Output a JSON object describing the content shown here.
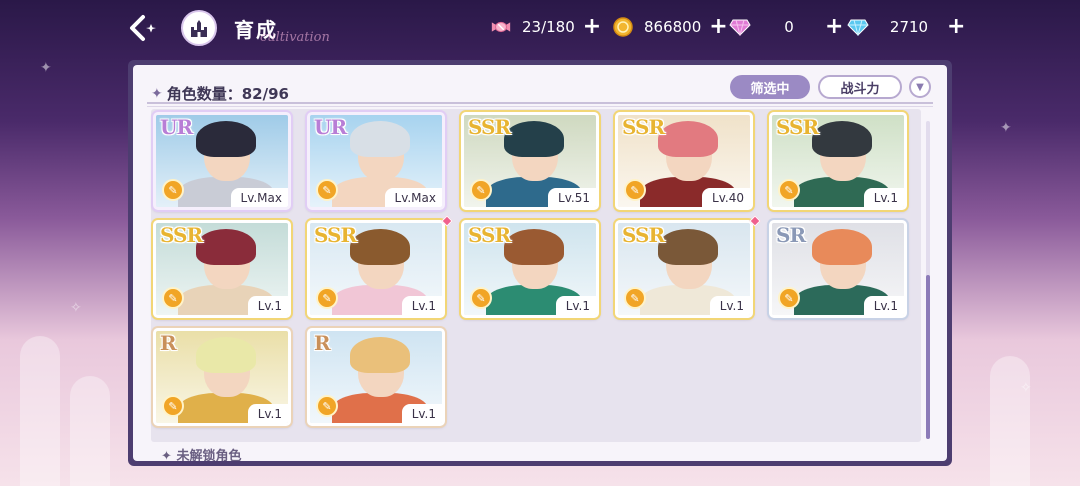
{
  "header": {
    "title": "育成",
    "title_script": "cultivation"
  },
  "resources": [
    {
      "name": "candy",
      "icon": "candy-icon",
      "value": "23/180",
      "color": "#f08fb0"
    },
    {
      "name": "coin",
      "icon": "coin-icon",
      "value": "866800",
      "color": "#f2b630"
    },
    {
      "name": "pink-diamond",
      "icon": "pink-diamond-icon",
      "value": "0",
      "color": "#e07ad4"
    },
    {
      "name": "blue-diamond",
      "icon": "blue-diamond-icon",
      "value": "2710",
      "color": "#5ac8f0"
    }
  ],
  "panel": {
    "count_label": "角色数量：82/96",
    "filter_label": "筛选中",
    "sort_label": "战斗力",
    "locked_label": "未解锁角色"
  },
  "characters": [
    {
      "rarity": "UR",
      "level": "Lv.Max",
      "sky": "#9fcbe8",
      "hair": "#2a2a3a",
      "body": "#c9ccd6",
      "new": false
    },
    {
      "rarity": "UR",
      "level": "Lv.Max",
      "sky": "#a7d3ef",
      "hair": "#d8dfe6",
      "body": "#f3d6c0",
      "new": false
    },
    {
      "rarity": "SSR",
      "level": "Lv.51",
      "sky": "#cfd9c0",
      "hair": "#24404a",
      "body": "#2e6a8c",
      "new": false
    },
    {
      "rarity": "SSR",
      "level": "Lv.40",
      "sky": "#f0e2c9",
      "hair": "#e27a80",
      "body": "#8a2a2a",
      "new": false
    },
    {
      "rarity": "SSR",
      "level": "Lv.1",
      "sky": "#cfe0c6",
      "hair": "#33393f",
      "body": "#2f6a54",
      "new": false
    },
    {
      "rarity": "SSR",
      "level": "Lv.1",
      "sky": "#c4dcd8",
      "hair": "#8a2c3a",
      "body": "#e8d3b8",
      "new": false
    },
    {
      "rarity": "SSR",
      "level": "Lv.1",
      "sky": "#d8e8f2",
      "hair": "#8a5a2e",
      "body": "#f1c6d6",
      "new": true
    },
    {
      "rarity": "SSR",
      "level": "Lv.1",
      "sky": "#cfe4ee",
      "hair": "#9a5a32",
      "body": "#2c8c72",
      "new": false
    },
    {
      "rarity": "SSR",
      "level": "Lv.1",
      "sky": "#d9e6ef",
      "hair": "#7a5838",
      "body": "#efe8d8",
      "new": true
    },
    {
      "rarity": "SR",
      "level": "Lv.1",
      "sky": "#dfe0e6",
      "hair": "#e88a5a",
      "body": "#2c6a5a",
      "new": false
    },
    {
      "rarity": "R",
      "level": "Lv.1",
      "sky": "#eadfa8",
      "hair": "#e9e8a8",
      "body": "#e0b04a",
      "new": false
    },
    {
      "rarity": "R",
      "level": "Lv.1",
      "sky": "#cfe4f2",
      "hair": "#eac07a",
      "body": "#e0704a",
      "new": false
    }
  ]
}
